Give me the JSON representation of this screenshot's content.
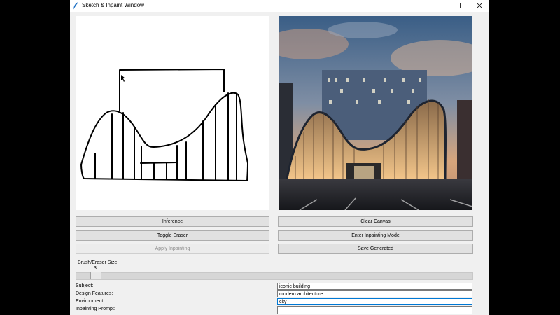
{
  "window": {
    "title": "Sketch & Inpaint Window",
    "controls": [
      "minimize-icon",
      "maximize-icon",
      "close-icon"
    ]
  },
  "buttons": {
    "inference": "Inference",
    "clear_canvas": "Clear Canvas",
    "toggle_eraser": "Toggle Eraser",
    "enter_inpainting": "Enter Inpainting Mode",
    "apply_inpainting": "Apply Inpainting",
    "save_generated": "Save Generated"
  },
  "brush": {
    "label": "Brush/Eraser Size",
    "value": "3"
  },
  "fields": {
    "subject": {
      "label": "Subject:",
      "value": "iconic building"
    },
    "design_features": {
      "label": "Design Features:",
      "value": "modern architecture"
    },
    "environment": {
      "label": "Environment:",
      "value": "city"
    },
    "inpainting_prompt": {
      "label": "Inpainting Prompt:",
      "value": ""
    }
  },
  "colors": {
    "accent": "#0078d4",
    "window_bg": "#f0f0f0",
    "button_bg": "#e1e1e1"
  }
}
